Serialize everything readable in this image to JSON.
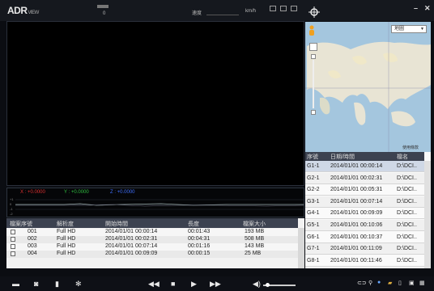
{
  "app": {
    "logo_text": "ADR",
    "logo_sub": "VIEW"
  },
  "top": {
    "field1": "0",
    "speed_label": "速度",
    "speed_unit": "km/h"
  },
  "graph": {
    "x_readout": "X : +0.0000",
    "y_readout": "Y : +0.0000",
    "z_readout": "Z : +0.0000",
    "scale_labels": [
      "+1",
      "0",
      "-1",
      "-2"
    ],
    "colors": {
      "x": "#e03030",
      "y": "#30c040",
      "z": "#4070ff"
    }
  },
  "map": {
    "type_select": "地圖",
    "copyright": "使用條款"
  },
  "filelist": {
    "headers": [
      "檔案序號",
      "解析度",
      "開始時間",
      "長度",
      "檔案大小"
    ],
    "rows": [
      {
        "no": "001",
        "res": "Full HD",
        "start": "2014/01/01 00:00:14",
        "len": "00:01:43",
        "size": "193 MB"
      },
      {
        "no": "002",
        "res": "Full HD",
        "start": "2014/01/01 00:02:31",
        "len": "00:04:31",
        "size": "508 MB"
      },
      {
        "no": "003",
        "res": "Full HD",
        "start": "2014/01/01 00:07:14",
        "len": "00:01:16",
        "size": "143 MB"
      },
      {
        "no": "004",
        "res": "Full HD",
        "start": "2014/01/01 00:09:09",
        "len": "00:00:15",
        "size": "25 MB"
      }
    ]
  },
  "events": {
    "headers": [
      "序號",
      "日期/時間",
      "檔名"
    ],
    "rows": [
      {
        "id": "G1-1",
        "time": "2014/01/01 00:00:14",
        "file": "D:\\DCI.."
      },
      {
        "id": "G2-1",
        "time": "2014/01/01 00:02:31",
        "file": "D:\\DCI.."
      },
      {
        "id": "G2-2",
        "time": "2014/01/01 00:05:31",
        "file": "D:\\DCI.."
      },
      {
        "id": "G3-1",
        "time": "2014/01/01 00:07:14",
        "file": "D:\\DCI.."
      },
      {
        "id": "G4-1",
        "time": "2014/01/01 00:09:09",
        "file": "D:\\DCI.."
      },
      {
        "id": "G5-1",
        "time": "2014/01/01 00:10:06",
        "file": "D:\\DCI.."
      },
      {
        "id": "G6-1",
        "time": "2014/01/01 00:10:37",
        "file": "D:\\DCI.."
      },
      {
        "id": "G7-1",
        "time": "2014/01/01 00:11:09",
        "file": "D:\\DCI.."
      },
      {
        "id": "G8-1",
        "time": "2014/01/01 00:11:46",
        "file": "D:\\DCI.."
      }
    ],
    "selected_index": 0
  }
}
